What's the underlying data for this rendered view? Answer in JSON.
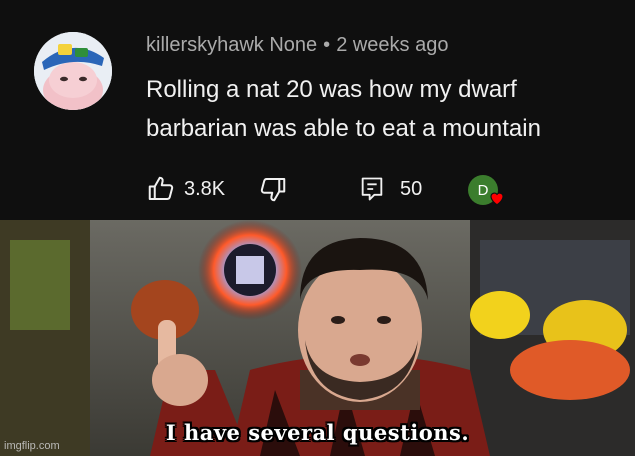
{
  "comment": {
    "author": "killerskyhawk None",
    "separator": "•",
    "time": "2 weeks ago",
    "text": "Rolling a nat 20 was how my dwarf barbarian was able to eat a mountain",
    "likes": "3.8K",
    "replies": "50",
    "hearted_by_initial": "D"
  },
  "icons": {
    "like": "thumbs-up-icon",
    "dislike": "thumbs-down-icon",
    "reply": "comment-icon",
    "heart": "heart-icon"
  },
  "meme": {
    "caption": "I have several questions.",
    "watermark": "imgflip.com"
  },
  "colors": {
    "background": "#0f0f0f",
    "meta_text": "#aaaaaa",
    "body_text": "#f1f1f1",
    "hearted_avatar": "#3b7d2d",
    "heart": "#ff0000"
  }
}
